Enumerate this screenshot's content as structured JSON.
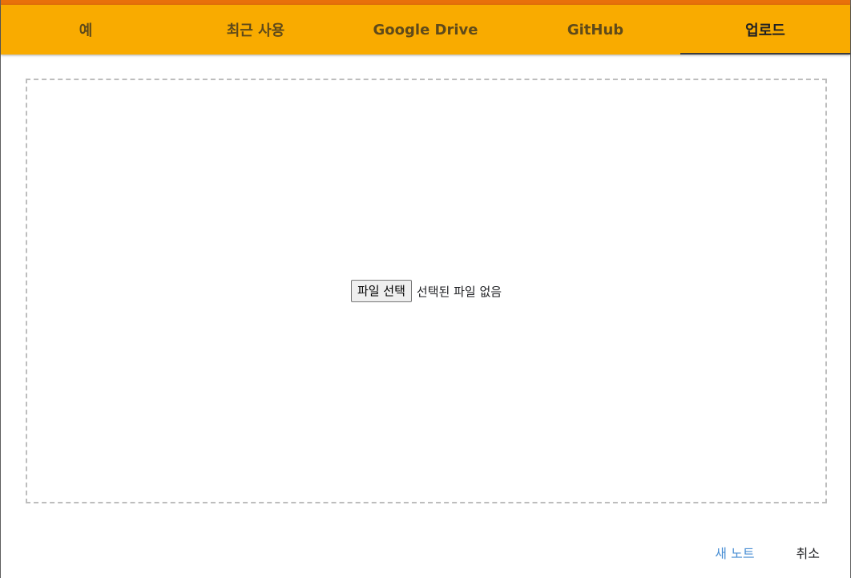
{
  "tabs": [
    {
      "label": "예",
      "active": false
    },
    {
      "label": "최근 사용",
      "active": false
    },
    {
      "label": "Google Drive",
      "active": false
    },
    {
      "label": "GitHub",
      "active": false
    },
    {
      "label": "업로드",
      "active": true
    }
  ],
  "upload": {
    "choose_file_label": "파일 선택",
    "no_file_text": "선택된 파일 없음"
  },
  "footer": {
    "new_notebook_label": "새 노트",
    "cancel_label": "취소"
  },
  "colors": {
    "accent_strip": "#e8710a",
    "tabbar": "#f9ab00",
    "link_blue": "#4a8fd4"
  }
}
